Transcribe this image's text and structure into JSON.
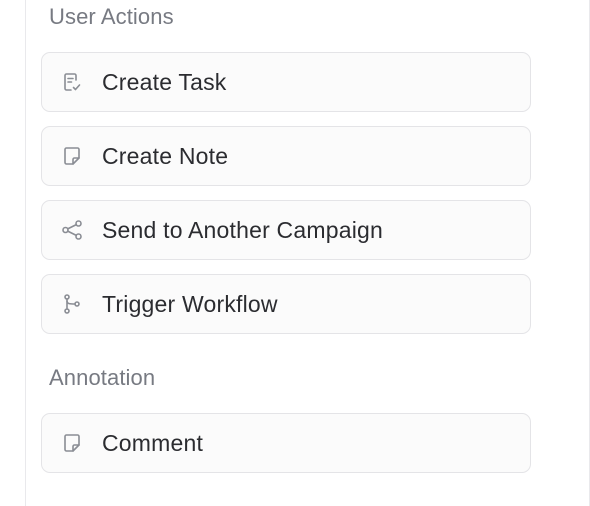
{
  "sections": [
    {
      "title": "User Actions",
      "items": [
        {
          "label": "Create Task",
          "icon": "task-icon"
        },
        {
          "label": "Create Note",
          "icon": "note-icon"
        },
        {
          "label": "Send to Another Campaign",
          "icon": "share-icon"
        },
        {
          "label": "Trigger Workflow",
          "icon": "workflow-branch-icon"
        }
      ]
    },
    {
      "title": "Annotation",
      "items": [
        {
          "label": "Comment",
          "icon": "note-icon"
        }
      ]
    }
  ],
  "colors": {
    "section_title": "#777a82",
    "item_label": "#2b2c30",
    "icon_stroke": "#8a8d94",
    "item_border": "#e4e4e7",
    "item_background": "#fbfbfb"
  }
}
